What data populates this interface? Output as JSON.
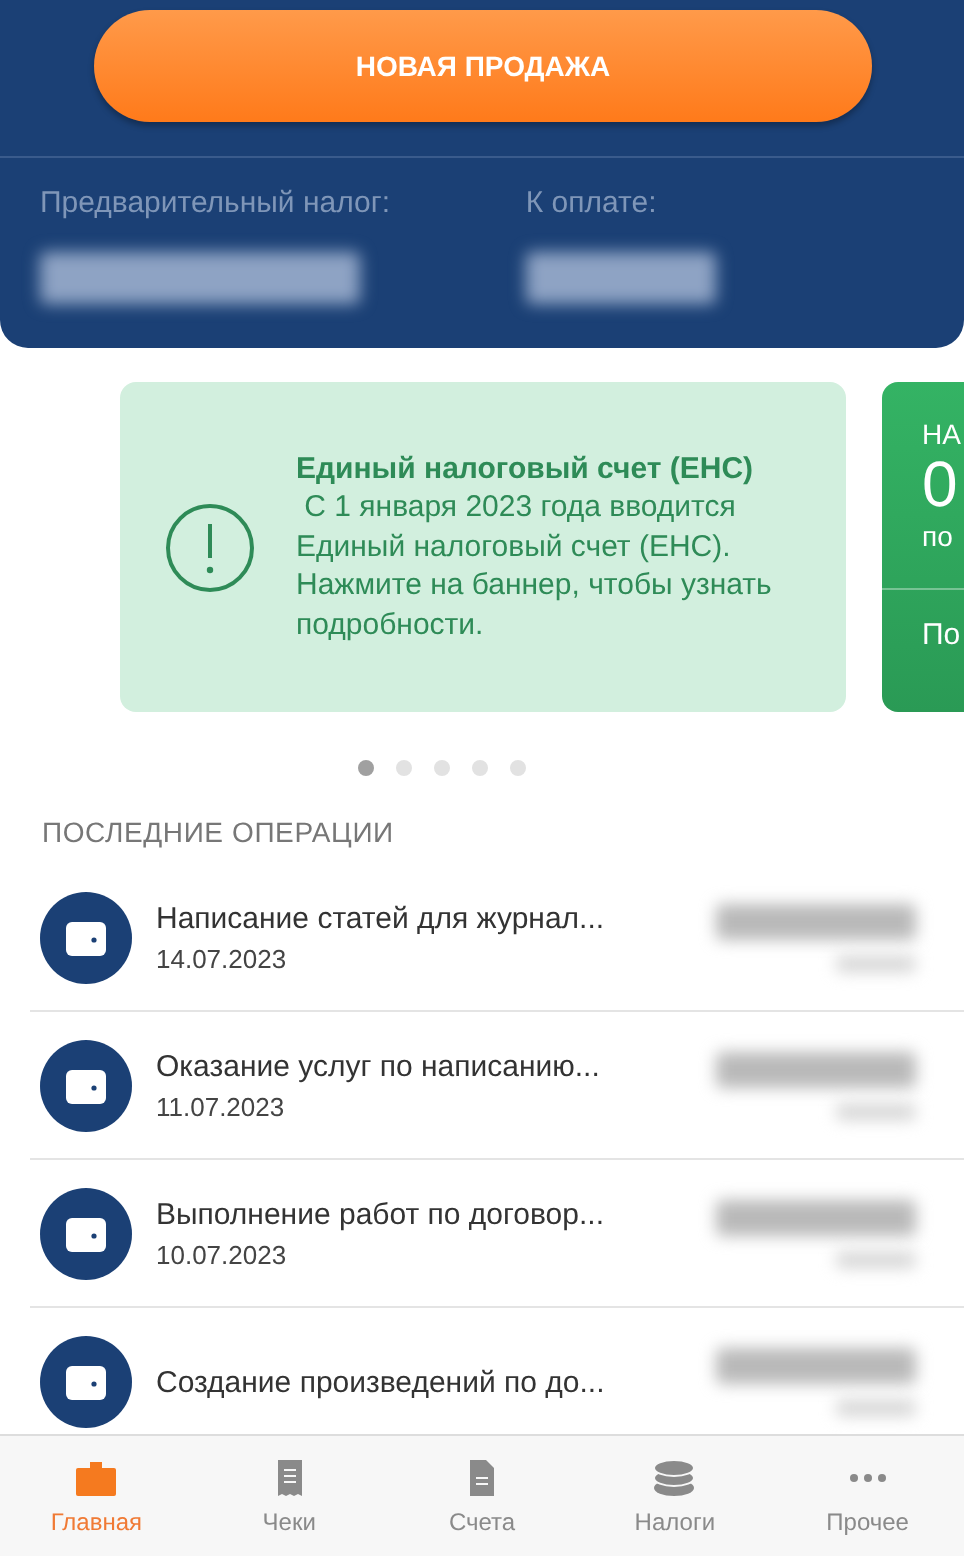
{
  "header": {
    "new_sale_button": "НОВАЯ ПРОДАЖА",
    "summary": [
      {
        "label": "Предварительный налог:"
      },
      {
        "label": "К оплате:"
      }
    ]
  },
  "banners": [
    {
      "kind": "info",
      "title": "Единый налоговый счет (ЕНС)",
      "text": " С 1 января 2023 года вводится Единый налоговый счет (ЕНС). Нажмите на баннер, чтобы узнать подробности."
    },
    {
      "kind": "tax",
      "heading": "НА",
      "amount": "0",
      "caption": "по",
      "action": "По"
    }
  ],
  "pager": [
    {
      "selected": true
    },
    {
      "selected": false
    },
    {
      "selected": false
    },
    {
      "selected": false
    },
    {
      "selected": false
    }
  ],
  "operations": {
    "title": "ПОСЛЕДНИЕ ОПЕРАЦИИ",
    "rows": [
      {
        "name": "Написание статей для журнал...",
        "date": "14.07.2023"
      },
      {
        "name": "Оказание услуг по написанию...",
        "date": "11.07.2023"
      },
      {
        "name": "Выполнение работ по договор...",
        "date": "10.07.2023"
      },
      {
        "name": "Создание произведений по до..."
      }
    ]
  },
  "tab_bar": [
    {
      "kind": "home",
      "label": "Главная",
      "selected": true
    },
    {
      "kind": "receipts",
      "label": "Чеки",
      "selected": false
    },
    {
      "kind": "invoices",
      "label": "Счета",
      "selected": false
    },
    {
      "kind": "taxes",
      "label": "Налоги",
      "selected": false
    },
    {
      "kind": "more",
      "label": "Прочее",
      "selected": false
    }
  ]
}
